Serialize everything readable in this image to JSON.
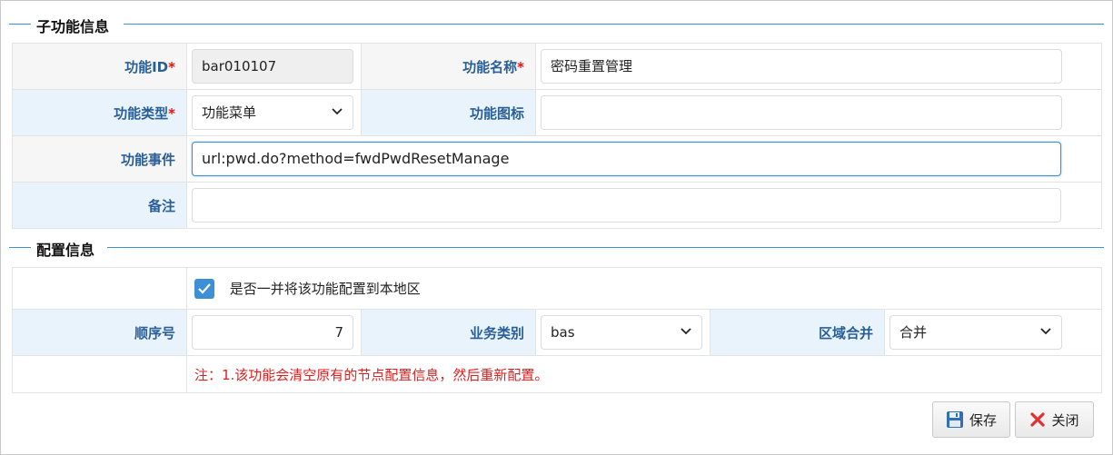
{
  "sections": {
    "sub_function": {
      "title": "子功能信息"
    },
    "config": {
      "title": "配置信息"
    }
  },
  "fields": {
    "function_id": {
      "label": "功能ID",
      "required_mark": "*",
      "value": "bar010107"
    },
    "function_name": {
      "label": "功能名称",
      "required_mark": "*",
      "value": "密码重置管理"
    },
    "function_type": {
      "label": "功能类型",
      "required_mark": "*",
      "value": "功能菜单"
    },
    "function_icon": {
      "label": "功能图标",
      "value": ""
    },
    "function_event": {
      "label": "功能事件",
      "value": "url:pwd.do?method=fwdPwdResetManage"
    },
    "remark": {
      "label": "备注",
      "value": ""
    }
  },
  "config": {
    "checkbox_label": "是否一并将该功能配置到本地区",
    "checkbox_checked": true,
    "order": {
      "label": "顺序号",
      "value": "7"
    },
    "business_type": {
      "label": "业务类别",
      "value": "bas"
    },
    "region_merge": {
      "label": "区域合并",
      "value": "合并"
    },
    "note": "注：1.该功能会清空原有的节点配置信息，然后重新配置。"
  },
  "buttons": {
    "save": "保存",
    "close": "关闭"
  },
  "colors": {
    "accent": "#3d8fd6",
    "label_text": "#2a5f96",
    "required": "#e11111",
    "note": "#e02020"
  }
}
